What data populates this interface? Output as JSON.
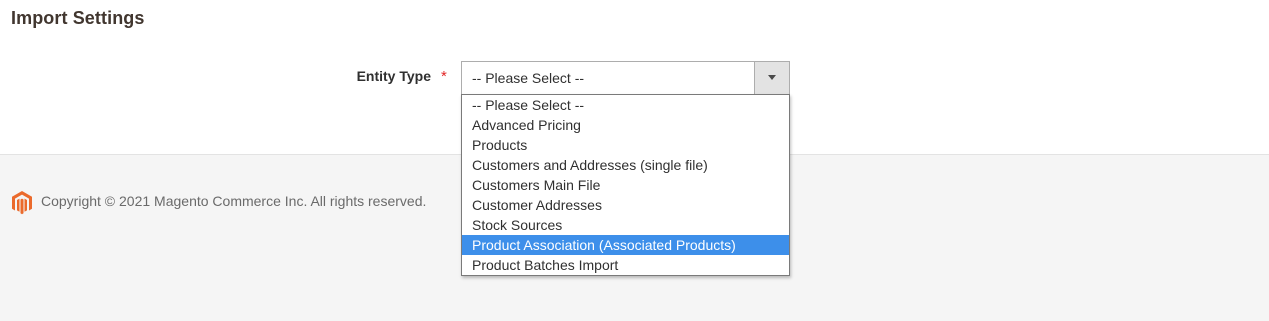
{
  "section": {
    "title": "Import Settings"
  },
  "entity_type": {
    "label": "Entity Type",
    "required_mark": "*",
    "selected_value": "-- Please Select --",
    "options": [
      "-- Please Select --",
      "Advanced Pricing",
      "Products",
      "Customers and Addresses (single file)",
      "Customers Main File",
      "Customer Addresses",
      "Stock Sources",
      "Product Association (Associated Products)",
      "Product Batches Import"
    ],
    "highlighted_option": "Product Association (Associated Products)"
  },
  "footer": {
    "copyright": "Copyright © 2021 Magento Commerce Inc. All rights reserved.",
    "logo_icon": "magento-logo-icon"
  },
  "colors": {
    "highlight": "#3d8fea",
    "required": "#e22626",
    "logo": "#eb6a2c"
  }
}
